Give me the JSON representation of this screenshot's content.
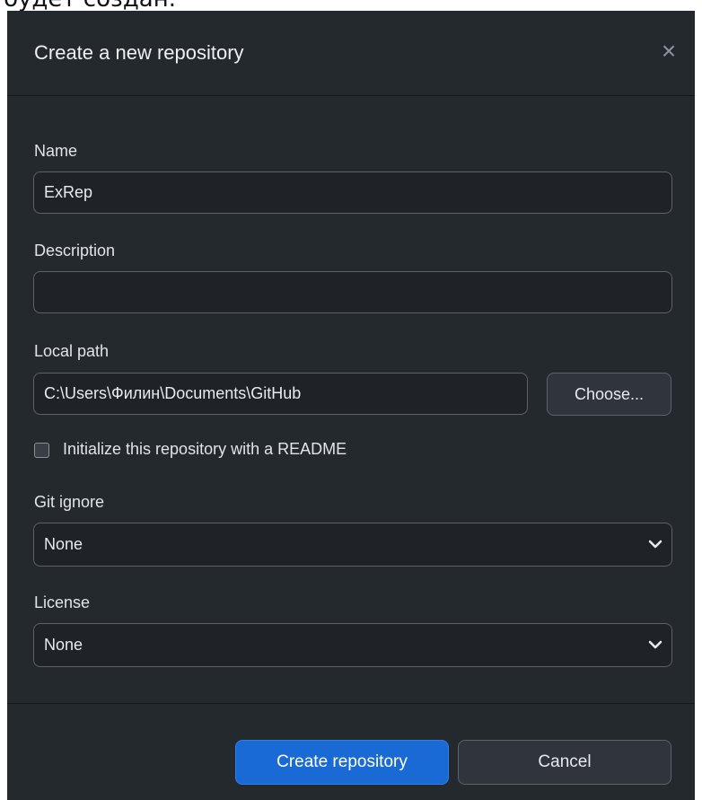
{
  "background_caption": "будет создан.",
  "dialog": {
    "title": "Create a new repository",
    "close_icon_glyph": "×"
  },
  "form": {
    "name": {
      "label": "Name",
      "value": "ExRep"
    },
    "description": {
      "label": "Description",
      "value": ""
    },
    "local_path": {
      "label": "Local path",
      "value": "C:\\Users\\Филин\\Documents\\GitHub",
      "choose_label": "Choose..."
    },
    "readme": {
      "label": "Initialize this repository with a README",
      "checked": false
    },
    "git_ignore": {
      "label": "Git ignore",
      "selected": "None"
    },
    "license": {
      "label": "License",
      "selected": "None"
    }
  },
  "footer": {
    "create_label": "Create repository",
    "cancel_label": "Cancel"
  },
  "colors": {
    "dialog_bg": "#24292e",
    "field_bg": "#1f2327",
    "border": "#5c6269",
    "primary": "#1a6ad6",
    "text": "#e8eaed"
  },
  "icons": {
    "close": "close-icon",
    "checkbox": "checkbox-icon",
    "dropdown": "chevron-down-icon"
  }
}
